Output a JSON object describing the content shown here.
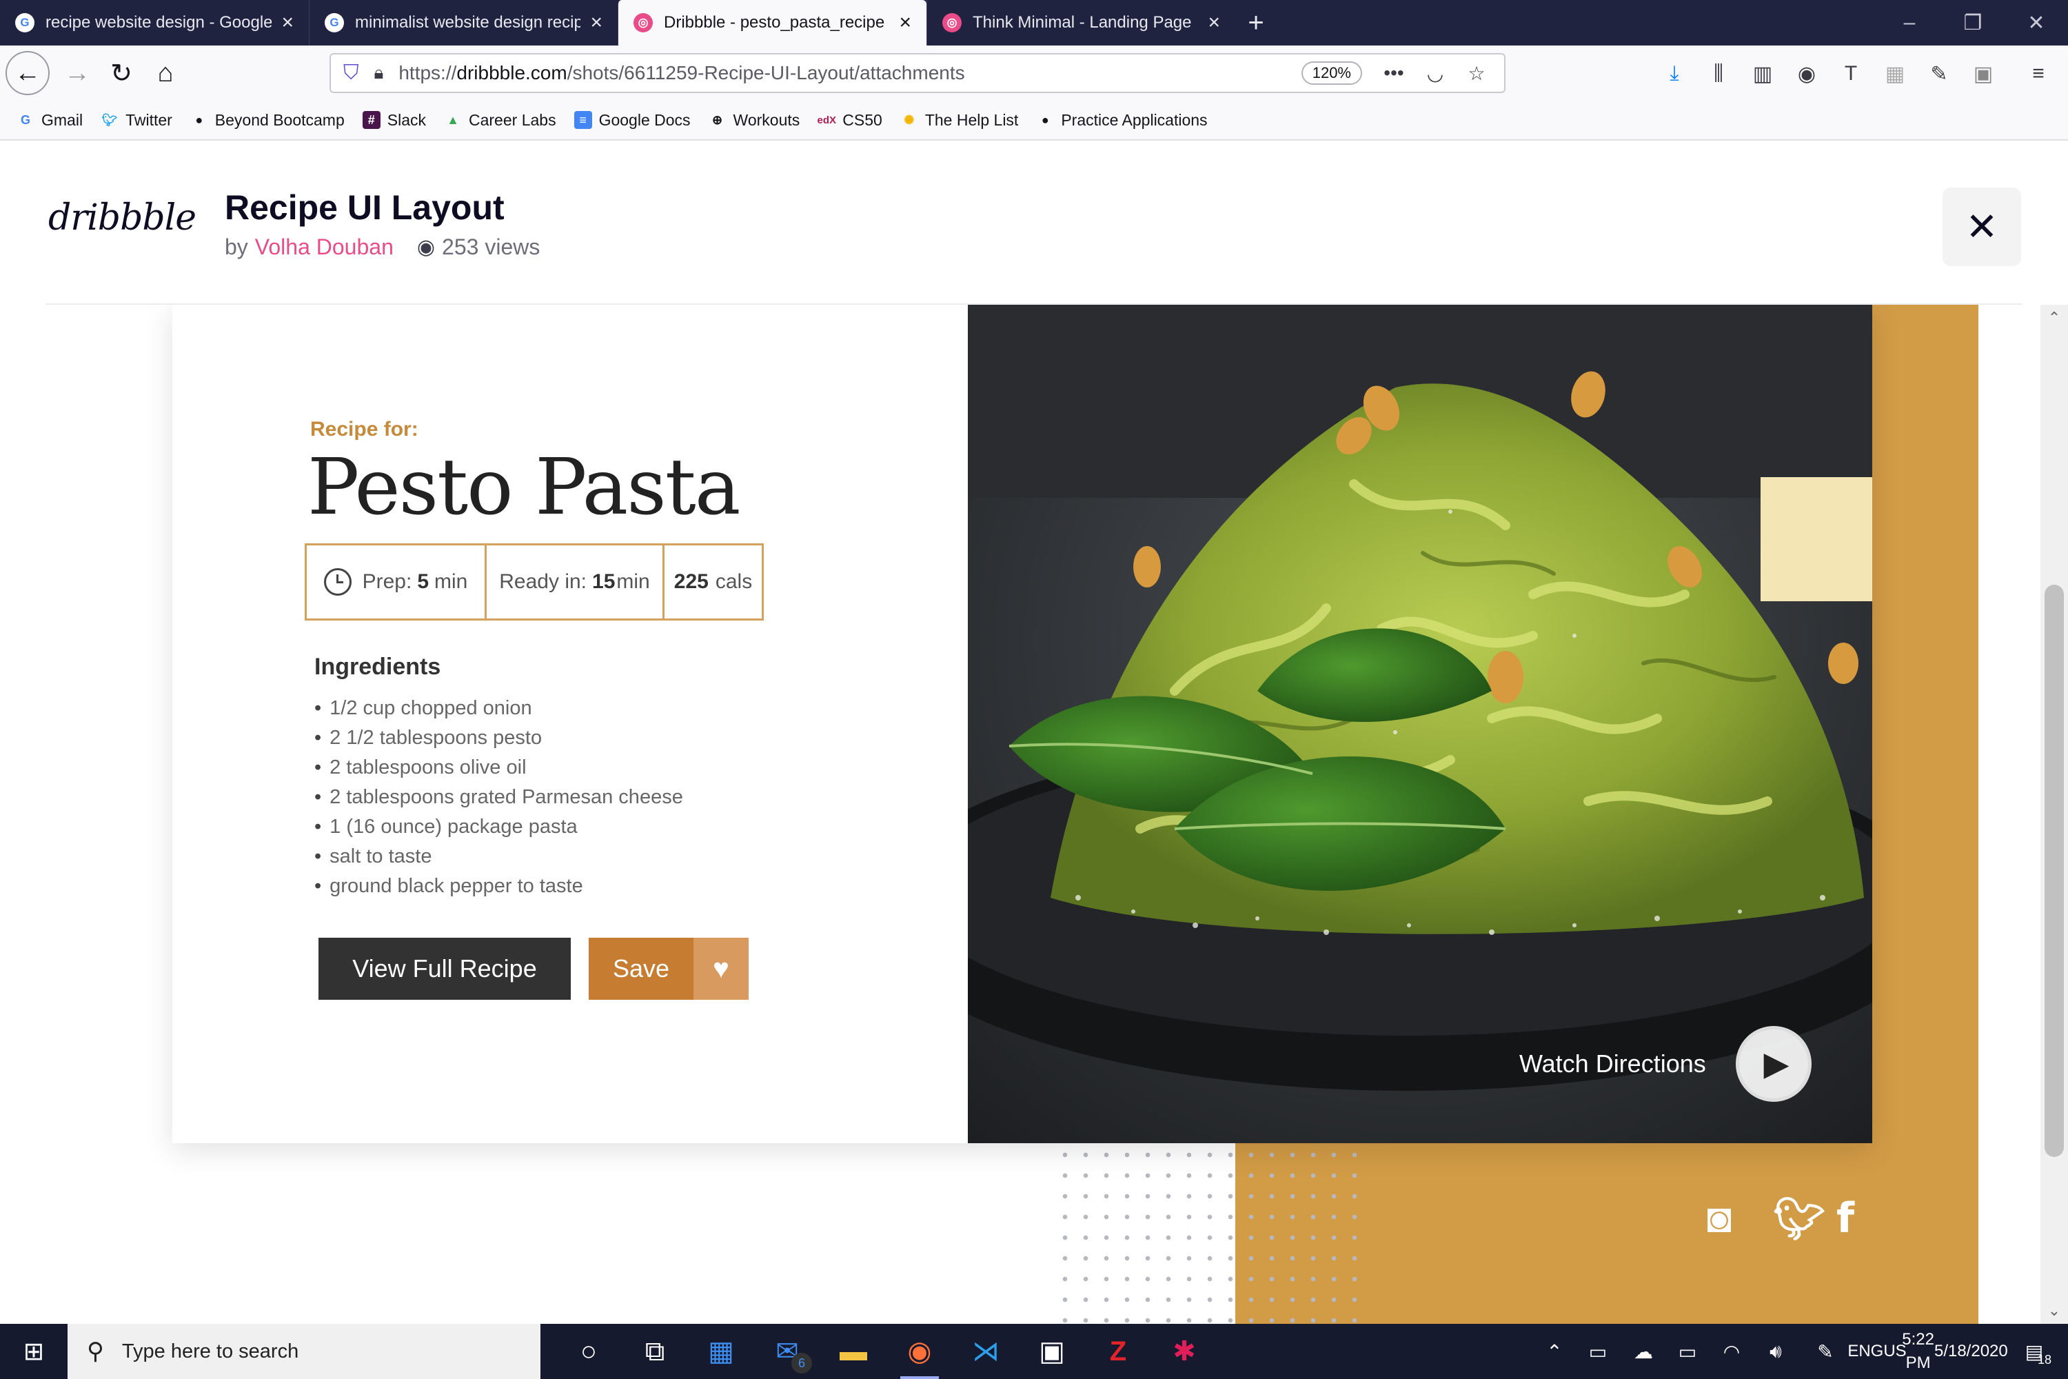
{
  "browser": {
    "tabs": [
      {
        "title": "recipe website design - Google",
        "favicon": "google-icon"
      },
      {
        "title": "minimalist website design recip",
        "favicon": "google-icon"
      },
      {
        "title": "Dribbble - pesto_pasta_recipe",
        "favicon": "dribbble-icon",
        "active": true
      },
      {
        "title": "Think Minimal - Landing Page",
        "favicon": "dribbble-icon"
      }
    ],
    "url_prefix": "https://",
    "url_domain": "dribbble.com",
    "url_path": "/shots/6611259-Recipe-UI-Layout/attachments",
    "zoom": "120%",
    "bookmarks": [
      {
        "label": "Gmail",
        "icon": "google-icon"
      },
      {
        "label": "Twitter",
        "icon": "twitter-icon"
      },
      {
        "label": "Beyond Bootcamp",
        "icon": "github-icon"
      },
      {
        "label": "Slack",
        "icon": "slack-icon"
      },
      {
        "label": "Career Labs",
        "icon": "drive-icon"
      },
      {
        "label": "Google Docs",
        "icon": "docs-icon"
      },
      {
        "label": "Workouts",
        "icon": "globe-icon"
      },
      {
        "label": "CS50",
        "icon": "edx-icon"
      },
      {
        "label": "The Help List",
        "icon": "sun-icon"
      },
      {
        "label": "Practice Applications",
        "icon": "github-icon"
      }
    ]
  },
  "shot": {
    "logo": "dribbble",
    "title": "Recipe UI Layout",
    "by": "by",
    "author": "Volha Douban",
    "views": "253 views",
    "close_icon": "close-icon"
  },
  "recipe": {
    "recipe_for": "Recipe for:",
    "name": "Pesto Pasta",
    "prep_label": "Prep:",
    "prep_value": "5",
    "prep_unit": "min",
    "ready_label": "Ready in:",
    "ready_value": "15",
    "ready_unit": "min",
    "cals_value": "225",
    "cals_unit": "cals",
    "ingredients_heading": "Ingredients",
    "ingredients": [
      "1/2 cup chopped onion",
      "2 1/2 tablespoons pesto",
      "2 tablespoons olive oil",
      "2 tablespoons grated Parmesan cheese",
      "1 (16 ounce) package pasta",
      "salt to taste",
      "ground black pepper to taste"
    ],
    "view_button": "View Full Recipe",
    "save_button": "Save",
    "watch_label": "Watch Directions"
  },
  "colors": {
    "accent_gold": "#d29b46",
    "save_orange": "#c67d32",
    "dark_button": "#323232",
    "dribbble_pink": "#ea4c89"
  },
  "taskbar": {
    "search_placeholder": "Type here to search",
    "mail_badge": "6",
    "lang_top": "ENG",
    "lang_bottom": "US",
    "time": "5:22 PM",
    "date": "5/18/2020",
    "notification_count": "18"
  }
}
